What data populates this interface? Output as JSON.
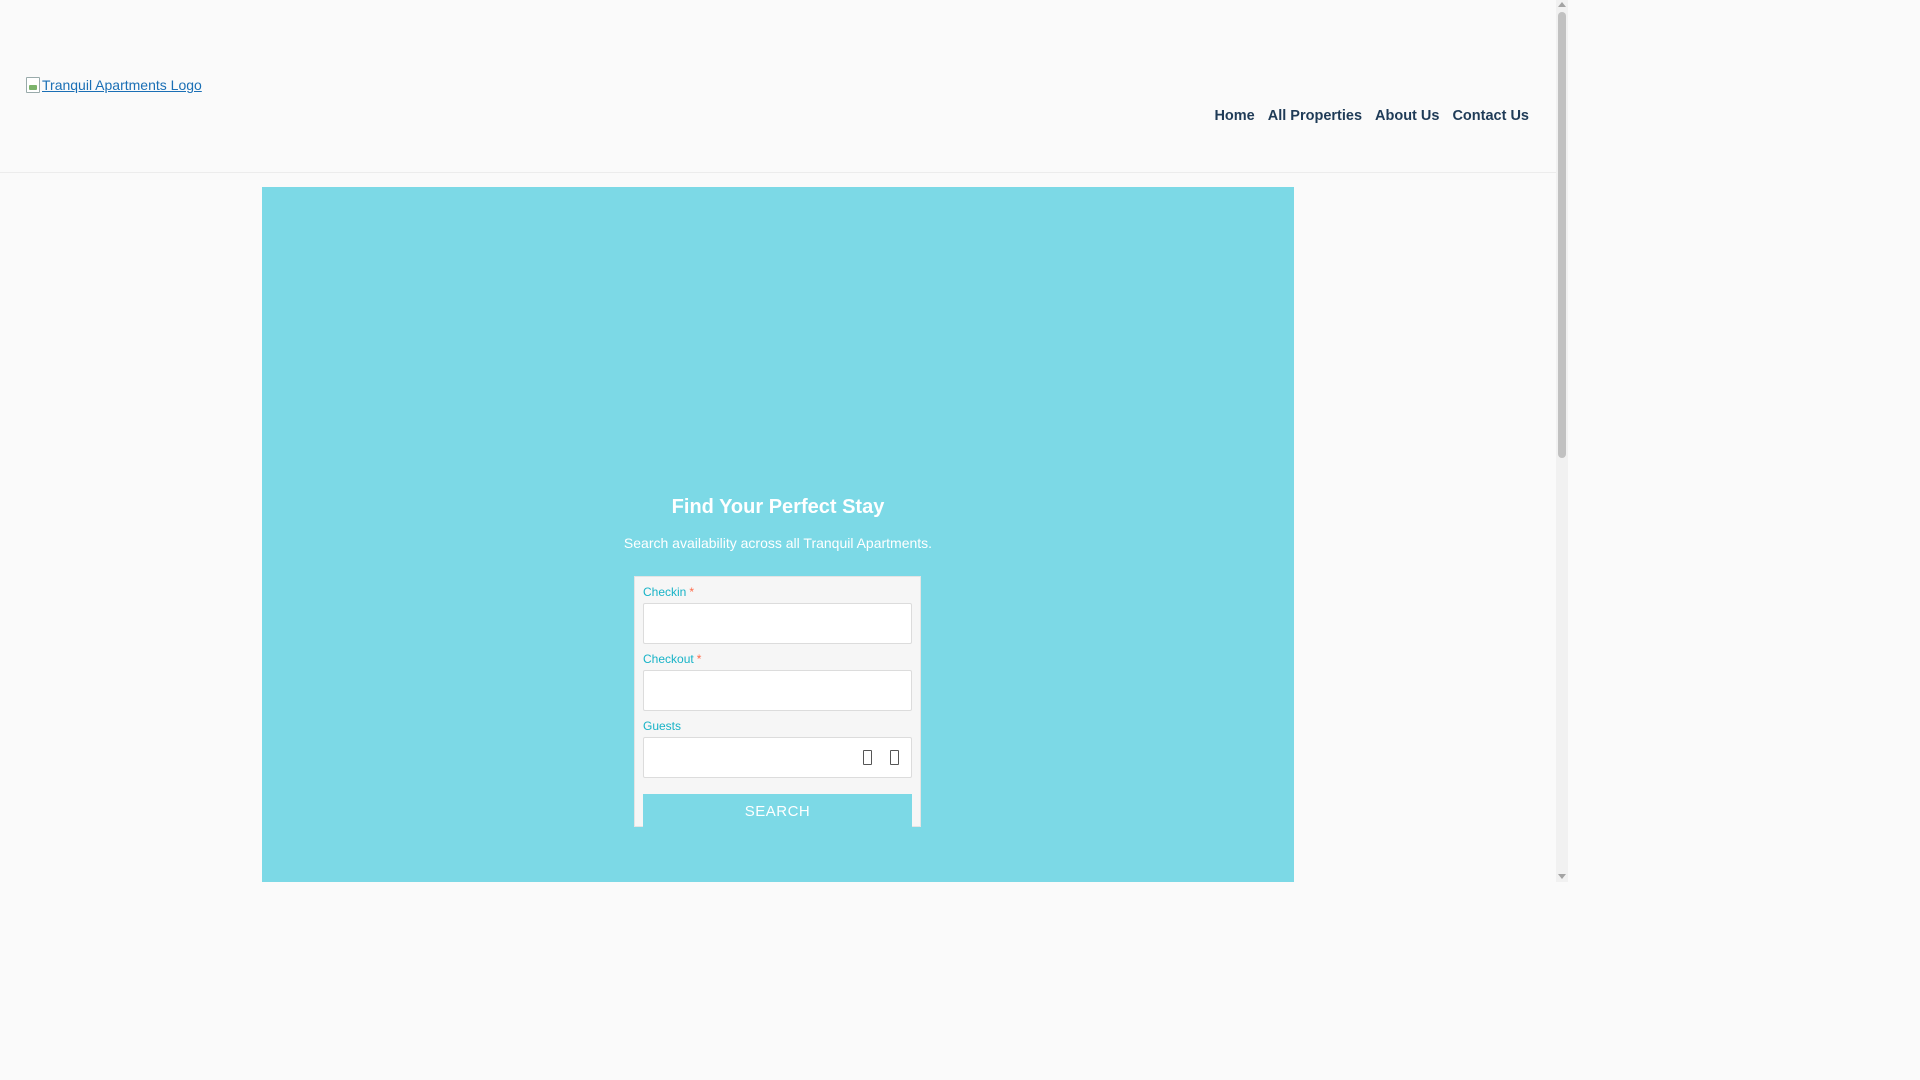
{
  "header": {
    "logo_alt": "Tranquil Apartments Logo",
    "nav": [
      "Home",
      "All Properties",
      "About Us",
      "Contact Us"
    ]
  },
  "hero": {
    "title": "Find Your Perfect Stay",
    "subtitle": "Search availability across all Tranquil Apartments."
  },
  "search_form": {
    "checkin_label": "Checkin",
    "checkout_label": "Checkout",
    "guests_label": "Guests",
    "required_marker": "*",
    "checkin_value": "",
    "checkout_value": "",
    "guests_value": "",
    "submit_label": "SEARCH"
  },
  "colors": {
    "hero_bg": "#7cd9e6",
    "label_accent": "#17b3c7",
    "nav_text": "#1f3b57",
    "required": "#ff6b4a"
  }
}
